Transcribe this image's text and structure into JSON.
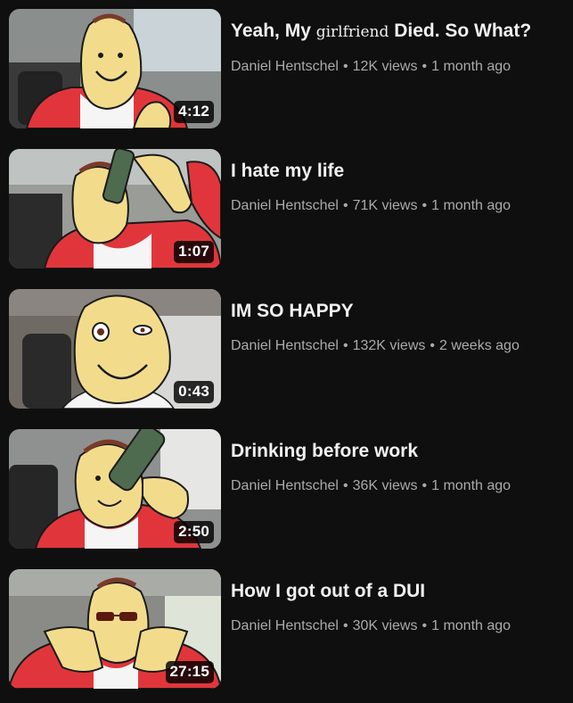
{
  "videos": [
    {
      "title_before": "Yeah, My ",
      "title_styled": "girlfriend",
      "title_after": " Died. So What?",
      "channel": "Daniel Hentschel",
      "views": "12K views",
      "age": "1 month ago",
      "duration": "4:12"
    },
    {
      "title": "I hate my life",
      "channel": "Daniel Hentschel",
      "views": "71K views",
      "age": "1 month ago",
      "duration": "1:07"
    },
    {
      "title": "IM SO HAPPY",
      "channel": "Daniel Hentschel",
      "views": "132K views",
      "age": "2 weeks ago",
      "duration": "0:43"
    },
    {
      "title": "Drinking before work",
      "channel": "Daniel Hentschel",
      "views": "36K views",
      "age": "1 month ago",
      "duration": "2:50"
    },
    {
      "title": "How I got out of a DUI",
      "channel": "Daniel Hentschel",
      "views": "30K views",
      "age": "1 month ago",
      "duration": "27:15"
    }
  ],
  "separator": "•",
  "colors": {
    "skin": "#f2dc8c",
    "shirt": "#e0363b",
    "outline": "#1a1a1a",
    "progress": "#ff0000"
  }
}
